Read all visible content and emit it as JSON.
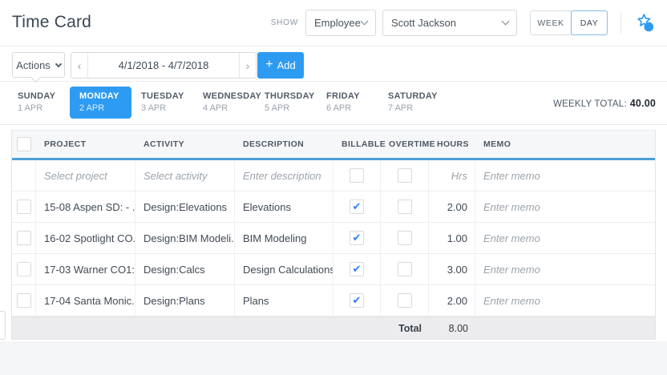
{
  "header": {
    "title": "Time Card",
    "show_label": "SHOW",
    "view_select_value": "Employee",
    "person_select_value": "Scott Jackson",
    "week_label": "WEEK",
    "day_label": "DAY",
    "active_view": "DAY"
  },
  "toolbar": {
    "actions_label": "Actions",
    "date_range": "4/1/2018 - 4/7/2018",
    "add_label": "Add"
  },
  "icons": {
    "check": "✔",
    "plus": "+",
    "chevron_left": "‹",
    "chevron_right": "›"
  },
  "week_nav": {
    "days": [
      {
        "name": "SUNDAY",
        "date": "1 APR",
        "active": false
      },
      {
        "name": "MONDAY",
        "date": "2 APR",
        "active": true
      },
      {
        "name": "TUESDAY",
        "date": "3 APR",
        "active": false
      },
      {
        "name": "WEDNESDAY",
        "date": "4 APR",
        "active": false
      },
      {
        "name": "THURSDAY",
        "date": "5 APR",
        "active": false
      },
      {
        "name": "FRIDAY",
        "date": "6 APR",
        "active": false
      },
      {
        "name": "SATURDAY",
        "date": "7 APR",
        "active": false
      }
    ],
    "weekly_total_label": "WEEKLY TOTAL:",
    "weekly_total_value": "40.00"
  },
  "table": {
    "columns": {
      "project": "PROJECT",
      "activity": "ACTIVITY",
      "description": "DESCRIPTION",
      "billable": "BILLABLE",
      "overtime": "OVERTIME",
      "hours": "HOURS",
      "memo": "MEMO"
    },
    "placeholder_row": {
      "project": "Select project",
      "activity": "Select activity",
      "description": "Enter description",
      "billable": false,
      "overtime": false,
      "hours": "Hrs",
      "memo": "Enter memo"
    },
    "rows": [
      {
        "project": "15-08 Aspen SD: - ...",
        "activity": "Design:Elevations",
        "description": "Elevations",
        "billable": true,
        "overtime": false,
        "hours": "2.00",
        "memo": "Enter memo"
      },
      {
        "project": "16-02 Spotlight CO...",
        "activity": "Design:BIM Modeli...",
        "description": "BIM Modeling",
        "billable": true,
        "overtime": false,
        "hours": "1.00",
        "memo": "Enter memo"
      },
      {
        "project": "17-03 Warner CO1:...",
        "activity": "Design:Calcs",
        "description": "Design Calculations",
        "billable": true,
        "overtime": false,
        "hours": "3.00",
        "memo": "Enter memo"
      },
      {
        "project": "17-04 Santa Monic...",
        "activity": "Design:Plans",
        "description": "Plans",
        "billable": true,
        "overtime": false,
        "hours": "2.00",
        "memo": "Enter memo"
      }
    ],
    "footer": {
      "total_label": "Total",
      "total_value": "8.00"
    }
  },
  "colors": {
    "accent_blue": "#2e9bf2",
    "table_header_underline": "#4c9fd7",
    "checkmark_blue": "#2d7ff2",
    "footer_gray": "#ececee"
  }
}
